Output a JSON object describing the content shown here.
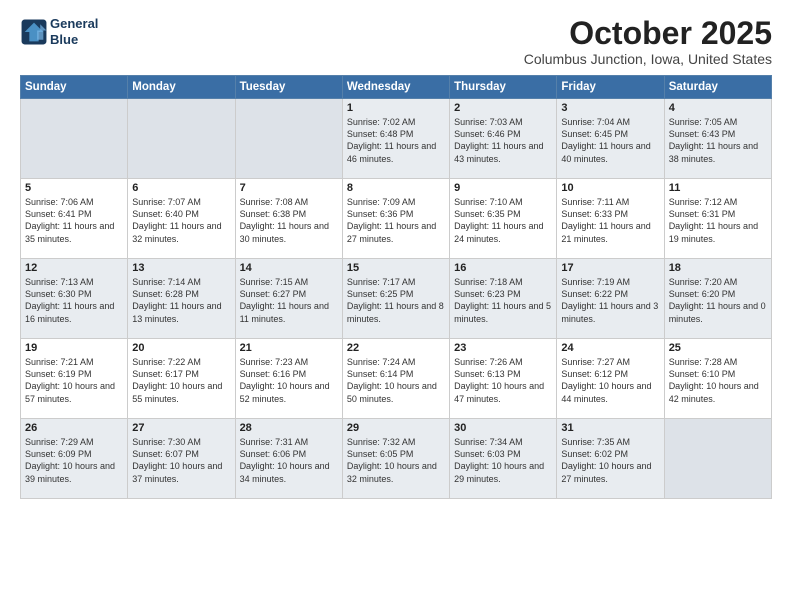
{
  "header": {
    "logo_line1": "General",
    "logo_line2": "Blue",
    "month": "October 2025",
    "location": "Columbus Junction, Iowa, United States"
  },
  "weekdays": [
    "Sunday",
    "Monday",
    "Tuesday",
    "Wednesday",
    "Thursday",
    "Friday",
    "Saturday"
  ],
  "weeks": [
    [
      {
        "day": "",
        "info": ""
      },
      {
        "day": "",
        "info": ""
      },
      {
        "day": "",
        "info": ""
      },
      {
        "day": "1",
        "info": "Sunrise: 7:02 AM\nSunset: 6:48 PM\nDaylight: 11 hours\nand 46 minutes."
      },
      {
        "day": "2",
        "info": "Sunrise: 7:03 AM\nSunset: 6:46 PM\nDaylight: 11 hours\nand 43 minutes."
      },
      {
        "day": "3",
        "info": "Sunrise: 7:04 AM\nSunset: 6:45 PM\nDaylight: 11 hours\nand 40 minutes."
      },
      {
        "day": "4",
        "info": "Sunrise: 7:05 AM\nSunset: 6:43 PM\nDaylight: 11 hours\nand 38 minutes."
      }
    ],
    [
      {
        "day": "5",
        "info": "Sunrise: 7:06 AM\nSunset: 6:41 PM\nDaylight: 11 hours\nand 35 minutes."
      },
      {
        "day": "6",
        "info": "Sunrise: 7:07 AM\nSunset: 6:40 PM\nDaylight: 11 hours\nand 32 minutes."
      },
      {
        "day": "7",
        "info": "Sunrise: 7:08 AM\nSunset: 6:38 PM\nDaylight: 11 hours\nand 30 minutes."
      },
      {
        "day": "8",
        "info": "Sunrise: 7:09 AM\nSunset: 6:36 PM\nDaylight: 11 hours\nand 27 minutes."
      },
      {
        "day": "9",
        "info": "Sunrise: 7:10 AM\nSunset: 6:35 PM\nDaylight: 11 hours\nand 24 minutes."
      },
      {
        "day": "10",
        "info": "Sunrise: 7:11 AM\nSunset: 6:33 PM\nDaylight: 11 hours\nand 21 minutes."
      },
      {
        "day": "11",
        "info": "Sunrise: 7:12 AM\nSunset: 6:31 PM\nDaylight: 11 hours\nand 19 minutes."
      }
    ],
    [
      {
        "day": "12",
        "info": "Sunrise: 7:13 AM\nSunset: 6:30 PM\nDaylight: 11 hours\nand 16 minutes."
      },
      {
        "day": "13",
        "info": "Sunrise: 7:14 AM\nSunset: 6:28 PM\nDaylight: 11 hours\nand 13 minutes."
      },
      {
        "day": "14",
        "info": "Sunrise: 7:15 AM\nSunset: 6:27 PM\nDaylight: 11 hours\nand 11 minutes."
      },
      {
        "day": "15",
        "info": "Sunrise: 7:17 AM\nSunset: 6:25 PM\nDaylight: 11 hours\nand 8 minutes."
      },
      {
        "day": "16",
        "info": "Sunrise: 7:18 AM\nSunset: 6:23 PM\nDaylight: 11 hours\nand 5 minutes."
      },
      {
        "day": "17",
        "info": "Sunrise: 7:19 AM\nSunset: 6:22 PM\nDaylight: 11 hours\nand 3 minutes."
      },
      {
        "day": "18",
        "info": "Sunrise: 7:20 AM\nSunset: 6:20 PM\nDaylight: 11 hours\nand 0 minutes."
      }
    ],
    [
      {
        "day": "19",
        "info": "Sunrise: 7:21 AM\nSunset: 6:19 PM\nDaylight: 10 hours\nand 57 minutes."
      },
      {
        "day": "20",
        "info": "Sunrise: 7:22 AM\nSunset: 6:17 PM\nDaylight: 10 hours\nand 55 minutes."
      },
      {
        "day": "21",
        "info": "Sunrise: 7:23 AM\nSunset: 6:16 PM\nDaylight: 10 hours\nand 52 minutes."
      },
      {
        "day": "22",
        "info": "Sunrise: 7:24 AM\nSunset: 6:14 PM\nDaylight: 10 hours\nand 50 minutes."
      },
      {
        "day": "23",
        "info": "Sunrise: 7:26 AM\nSunset: 6:13 PM\nDaylight: 10 hours\nand 47 minutes."
      },
      {
        "day": "24",
        "info": "Sunrise: 7:27 AM\nSunset: 6:12 PM\nDaylight: 10 hours\nand 44 minutes."
      },
      {
        "day": "25",
        "info": "Sunrise: 7:28 AM\nSunset: 6:10 PM\nDaylight: 10 hours\nand 42 minutes."
      }
    ],
    [
      {
        "day": "26",
        "info": "Sunrise: 7:29 AM\nSunset: 6:09 PM\nDaylight: 10 hours\nand 39 minutes."
      },
      {
        "day": "27",
        "info": "Sunrise: 7:30 AM\nSunset: 6:07 PM\nDaylight: 10 hours\nand 37 minutes."
      },
      {
        "day": "28",
        "info": "Sunrise: 7:31 AM\nSunset: 6:06 PM\nDaylight: 10 hours\nand 34 minutes."
      },
      {
        "day": "29",
        "info": "Sunrise: 7:32 AM\nSunset: 6:05 PM\nDaylight: 10 hours\nand 32 minutes."
      },
      {
        "day": "30",
        "info": "Sunrise: 7:34 AM\nSunset: 6:03 PM\nDaylight: 10 hours\nand 29 minutes."
      },
      {
        "day": "31",
        "info": "Sunrise: 7:35 AM\nSunset: 6:02 PM\nDaylight: 10 hours\nand 27 minutes."
      },
      {
        "day": "",
        "info": ""
      }
    ]
  ]
}
